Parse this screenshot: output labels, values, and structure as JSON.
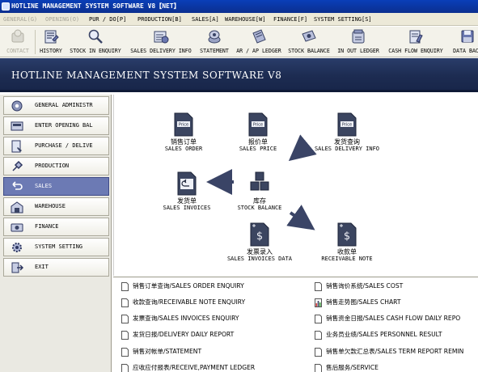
{
  "window": {
    "title": "HOTLINE MANAGEMENT SYSTEM SOFTWARE V8【NET】"
  },
  "menubar": {
    "items": [
      {
        "label": "GENERAL(G)",
        "enabled": false
      },
      {
        "label": "OPENING(O)",
        "enabled": false
      },
      {
        "label": "PUR / DO[P]",
        "enabled": true
      },
      {
        "label": "PRODUCTION[B]",
        "enabled": true
      },
      {
        "label": "SALES[A]",
        "enabled": true
      },
      {
        "label": "WAREHOUSE[W]",
        "enabled": true
      },
      {
        "label": "FINANCE[F]",
        "enabled": true
      },
      {
        "label": "SYSTEM SETTING[S]",
        "enabled": true
      }
    ]
  },
  "toolbar": {
    "items": [
      {
        "label": "CONTACT",
        "icon": "contact-icon",
        "enabled": false
      },
      {
        "label": "HISTORY",
        "icon": "history-icon",
        "enabled": true
      },
      {
        "label": "STOCK IN ENQUIRY",
        "icon": "magnifier-icon",
        "enabled": true
      },
      {
        "label": "SALES DELIVERY INFO",
        "icon": "delivery-icon",
        "enabled": true
      },
      {
        "label": "STATEMENT",
        "icon": "statement-icon",
        "enabled": true
      },
      {
        "label": "AR / AP LEDGER",
        "icon": "ledger-icon",
        "enabled": true
      },
      {
        "label": "STOCK BALANCE",
        "icon": "stock-balance-icon",
        "enabled": true
      },
      {
        "label": "IN OUT LEDGER",
        "icon": "in-out-ledger-icon",
        "enabled": true
      },
      {
        "label": "CASH FLOW ENQUIRY",
        "icon": "cash-flow-icon",
        "enabled": true
      },
      {
        "label": "DATA BACK",
        "icon": "data-backup-icon",
        "enabled": true
      }
    ]
  },
  "banner": {
    "title": "HOTLINE MANAGEMENT SYSTEM SOFTWARE V8"
  },
  "sidebar": {
    "items": [
      {
        "label": "GENERAL ADMINISTR",
        "icon": "general-admin-icon",
        "active": false
      },
      {
        "label": "ENTER OPENING BAL",
        "icon": "opening-balance-icon",
        "active": false
      },
      {
        "label": "PURCHASE / DELIVE",
        "icon": "purchase-icon",
        "active": false
      },
      {
        "label": "PRODUCTION",
        "icon": "production-icon",
        "active": false
      },
      {
        "label": "SALES",
        "icon": "sales-icon",
        "active": true
      },
      {
        "label": "WAREHOUSE",
        "icon": "warehouse-icon",
        "active": false
      },
      {
        "label": "FINANCE",
        "icon": "finance-icon",
        "active": false
      },
      {
        "label": "SYSTEM SETTING",
        "icon": "system-setting-icon",
        "active": false
      },
      {
        "label": "EXIT",
        "icon": "exit-icon",
        "active": false
      }
    ]
  },
  "flow": {
    "nodes": {
      "sales_order": {
        "cn": "销售订单",
        "en": "SALES ORDER",
        "icon": "price-document-icon"
      },
      "sales_price": {
        "cn": "报价单",
        "en": "SALES PRICE",
        "icon": "price-document-icon"
      },
      "delivery_info": {
        "cn": "发货查询",
        "en": "SALES DELIVERY INFO",
        "icon": "price-document-icon"
      },
      "sales_invoices": {
        "cn": "发货单",
        "en": "SALES INVOICES",
        "icon": "return-document-icon"
      },
      "stock_balance": {
        "cn": "库存",
        "en": "STOCK BALANCE",
        "icon": "boxes-icon"
      },
      "invoice_data": {
        "cn": "发票录入",
        "en": "SALES INVOICES DATA",
        "icon": "dollar-document-icon"
      },
      "receivable": {
        "cn": "收款单",
        "en": "RECEIVABLE NOTE",
        "icon": "dollar-document-icon"
      }
    },
    "colors": {
      "arrow": "#3a4466",
      "doc": "#3b4560",
      "paper": "#eef0f6"
    }
  },
  "links": {
    "left": [
      {
        "text": "销售订单查询/SALES ORDER ENQUIRY",
        "icon": "document-icon"
      },
      {
        "text": "收款查询/RECEIVABLE NOTE ENQUIRY",
        "icon": "document-icon"
      },
      {
        "text": "发票查询/SALES INVOICES ENQUIRY",
        "icon": "document-icon"
      },
      {
        "text": "发货日报/DELIVERY DAILY REPORT",
        "icon": "document-icon"
      },
      {
        "text": "销售对帐单/STATEMENT",
        "icon": "document-icon"
      },
      {
        "text": "应收应付报表/RECEIVE,PAYMENT LEDGER",
        "icon": "document-icon"
      }
    ],
    "right": [
      {
        "text": "销售询价系统/SALES COST",
        "icon": "document-icon"
      },
      {
        "text": "销售走势图/SALES CHART",
        "icon": "bar-chart-icon"
      },
      {
        "text": "销售资金日报/SALES CASH FLOW DAILY REPO",
        "icon": "document-icon"
      },
      {
        "text": "业务员业绩/SALES PERSONNEL RESULT",
        "icon": "document-icon"
      },
      {
        "text": "销售单欠款汇总表/SALES TERM REPORT REMIN",
        "icon": "document-icon"
      },
      {
        "text": "售后服务/SERVICE",
        "icon": "document-icon"
      }
    ]
  }
}
